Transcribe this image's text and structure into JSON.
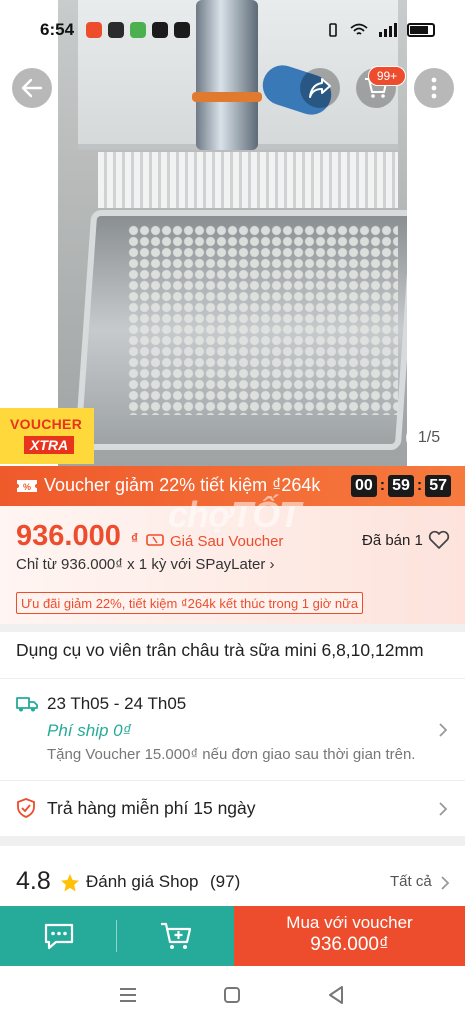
{
  "status_bar": {
    "time": "6:54"
  },
  "header": {
    "cart_badge": "99+",
    "icons": [
      "back-arrow-icon",
      "share-icon",
      "cart-icon",
      "more-icon"
    ]
  },
  "gallery": {
    "voucher_logo_line1": "VOUCHER",
    "voucher_logo_line2": "XTRA",
    "page_indicator": "1/5"
  },
  "flash_voucher": {
    "text": "Voucher giảm 22% tiết kiệm ₫264k",
    "countdown": {
      "hours": "00",
      "minutes": "59",
      "seconds": "57"
    }
  },
  "price": {
    "value": "936.000",
    "currency": "₫",
    "label": "Giá Sau Voucher",
    "sold": "Đã bán 1",
    "installment": "Chỉ từ 936.000₫ x 1 kỳ với SPayLater ›",
    "promo": "Ưu đãi giảm 22%, tiết kiệm ₫264k kết thúc trong 1 giờ nữa",
    "watermark": "chợTỐT"
  },
  "product": {
    "title": "Dụng cụ vo viên trân châu trà sữa mini 6,8,10,12mm"
  },
  "shipping": {
    "date": "23 Th05 - 24 Th05",
    "fee": "Phí ship 0₫",
    "note": "Tặng Voucher 15.000₫ nếu đơn giao sau thời gian trên."
  },
  "returns": {
    "text": "Trả hàng miễn phí 15 ngày"
  },
  "rating": {
    "score": "4.8",
    "label": "Đánh giá Shop",
    "count": "(97)",
    "see_all": "Tất cả"
  },
  "action_bar": {
    "buy_label": "Mua với voucher",
    "buy_price": "936.000₫"
  },
  "colors": {
    "brand": "#ee4d2d",
    "teal": "#26aa99"
  }
}
